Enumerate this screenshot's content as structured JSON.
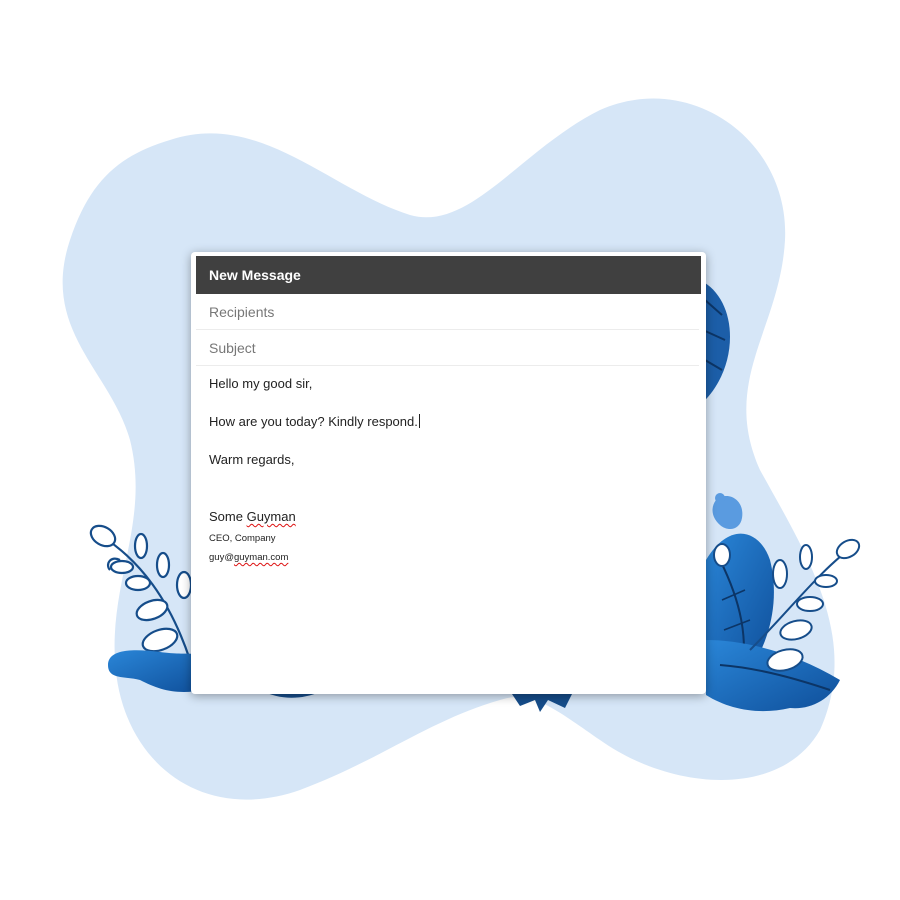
{
  "compose": {
    "title": "New Message",
    "recipients_placeholder": "Recipients",
    "subject_placeholder": "Subject",
    "body": {
      "greeting": "Hello my good sir,",
      "message": "How are you today? Kindly respond.",
      "closing": "Warm regards,",
      "signature_first": "Some ",
      "signature_last": "Guyman",
      "signature_title": "CEO, Company",
      "signature_email_prefix": "guy@",
      "signature_email_domain": "guyman.com"
    }
  },
  "colors": {
    "background_blob": "#d6e6f7",
    "accent_blue": "#1f6fc2",
    "dark_blue": "#103a6e",
    "header_bg": "#404040"
  },
  "icons": {
    "decor_left": "leafy-branch-illustration",
    "decor_right": "leafy-branch-illustration"
  }
}
